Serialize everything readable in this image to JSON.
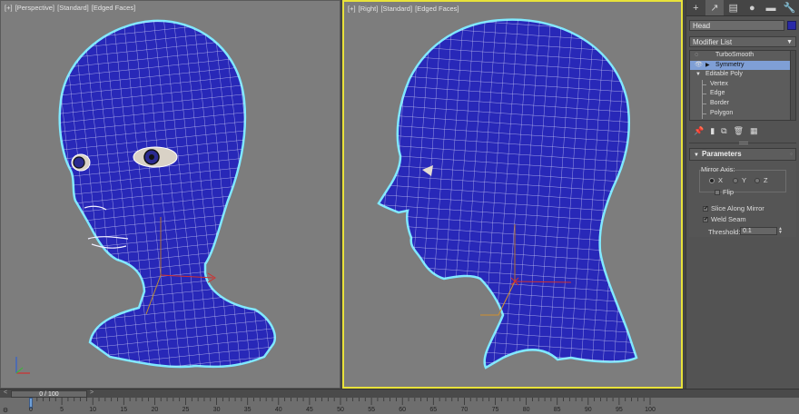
{
  "viewports": [
    {
      "id": "left",
      "bracket": "[+]",
      "view": "[Perspective]",
      "shading": "[Standard]",
      "mode": "[Edged Faces]"
    },
    {
      "id": "right",
      "bracket": "[+]",
      "view": "[Right]",
      "shading": "[Standard]",
      "mode": "[Edged Faces]"
    }
  ],
  "panel": {
    "tabs": [
      "create-icon",
      "modify-icon",
      "hierarchy-icon",
      "motion-icon",
      "display-icon",
      "utilities-icon"
    ],
    "tab_glyphs": [
      "+",
      "↗",
      "▤",
      "●",
      "▬",
      "🔧"
    ],
    "object_name": "Head",
    "object_color": "#2a2aa8",
    "modifier_list": "Modifier List",
    "stack": [
      {
        "label": "TurboSmooth",
        "kind": "modifier"
      },
      {
        "label": "Symmetry",
        "kind": "modifier",
        "selected": true
      },
      {
        "label": "Editable Poly",
        "kind": "base"
      },
      {
        "label": "Vertex",
        "kind": "sub"
      },
      {
        "label": "Edge",
        "kind": "sub"
      },
      {
        "label": "Border",
        "kind": "sub"
      },
      {
        "label": "Polygon",
        "kind": "sub"
      }
    ],
    "rollout_title": "Parameters",
    "mirror_axis_label": "Mirror Axis:",
    "axes": [
      "X",
      "Y",
      "Z"
    ],
    "selected_axis": "X",
    "flip_label": "Flip",
    "flip_checked": false,
    "slice_label": "Slice Along Mirror",
    "slice_checked": true,
    "weld_label": "Weld Seam",
    "weld_checked": true,
    "threshold_label": "Threshold:",
    "threshold_value": "0.1"
  },
  "timeline": {
    "frame_display": "0 / 100",
    "ruler_labels": [
      "0",
      "5",
      "10",
      "15",
      "20",
      "25",
      "30",
      "35",
      "40",
      "45",
      "50",
      "55",
      "60",
      "65",
      "70",
      "75",
      "80",
      "85",
      "90",
      "95",
      "100"
    ]
  },
  "colors": {
    "mesh": "#2828b8",
    "outline": "#7fe8ff",
    "active_viewport_border": "#e8e23a",
    "viewport_bg": "#7d7d7d"
  }
}
